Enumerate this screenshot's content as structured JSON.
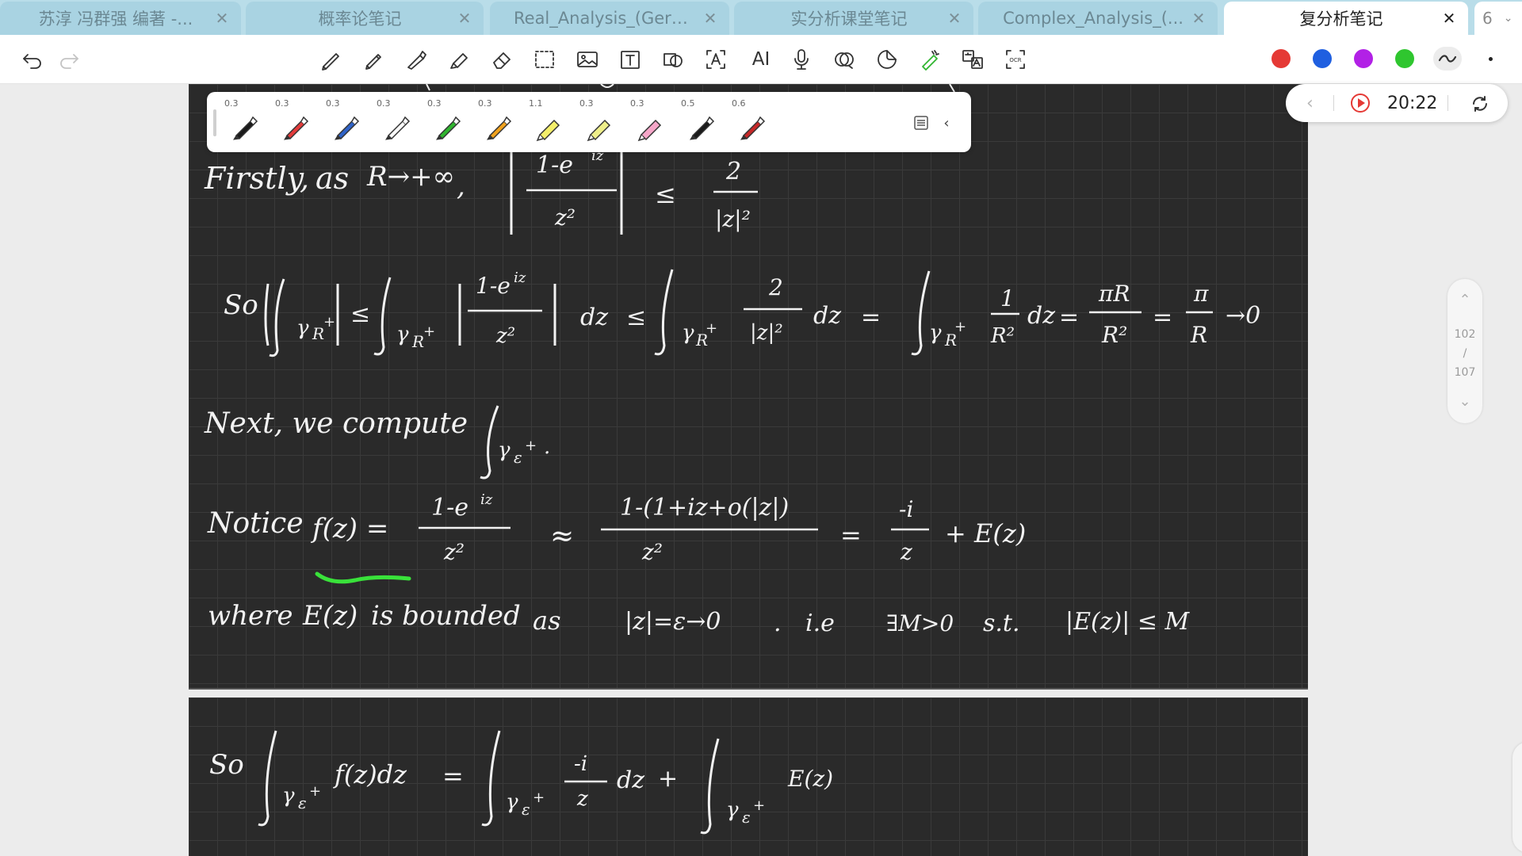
{
  "tabs": [
    {
      "label": "苏淳 冯群强 编著 -...",
      "active": false
    },
    {
      "label": "概率论笔记",
      "active": false
    },
    {
      "label": "Real_Analysis_(Gera...",
      "active": false
    },
    {
      "label": "实分析课堂笔记",
      "active": false
    },
    {
      "label": "Complex_Analysis_(...",
      "active": false
    },
    {
      "label": "复分析笔记",
      "active": true
    }
  ],
  "tab_overflow": {
    "count": "6",
    "chevron": "chevron-down-icon"
  },
  "toolbar": {
    "tools": [
      "pen-icon",
      "pencil-icon",
      "fountain-pen-icon",
      "highlighter-icon",
      "eraser-icon",
      "lasso-select-icon",
      "image-icon",
      "text-box-icon",
      "shapes-icon",
      "ocr-text-icon",
      "ai-icon",
      "microphone-icon",
      "scissors-icon",
      "sticker-icon",
      "laser-pointer-icon",
      "translate-icon",
      "ocr-scan-icon"
    ],
    "text_box": "T",
    "ocr_text": "A",
    "ai": "AI",
    "ocr_scan": "OCR",
    "colors": [
      "#e53935",
      "#1f5fe0",
      "#b221e6",
      "#2fc62f"
    ]
  },
  "pen_palette": {
    "pens": [
      {
        "size": "0.3",
        "color": "#1a1a1a",
        "kind": "pen"
      },
      {
        "size": "0.3",
        "color": "#e23b3b",
        "kind": "pen"
      },
      {
        "size": "0.3",
        "color": "#2f63c8",
        "kind": "pen"
      },
      {
        "size": "0.3",
        "color": "#ffffff",
        "kind": "pen"
      },
      {
        "size": "0.3",
        "color": "#2fb52f",
        "kind": "pen"
      },
      {
        "size": "0.3",
        "color": "#f0a21e",
        "kind": "pen"
      },
      {
        "size": "1.1",
        "color": "#f3ee6a",
        "kind": "highlighter"
      },
      {
        "size": "0.3",
        "color": "#eeee8a",
        "kind": "highlighter"
      },
      {
        "size": "0.3",
        "color": "#f5a6c8",
        "kind": "highlighter"
      },
      {
        "size": "0.5",
        "color": "#1a1a1a",
        "kind": "pen"
      },
      {
        "size": "0.6",
        "color": "#c62828",
        "kind": "pen"
      }
    ]
  },
  "timer": {
    "time": "20:22"
  },
  "page_nav": {
    "current": "102",
    "separator": "/",
    "total": "107"
  },
  "notes": {
    "line1": {
      "firstly": "Firstly,",
      "as": "as",
      "limit": "R→+∞",
      "comma": ",",
      "num": "1-e",
      "num_sup": "iz",
      "den": "z²",
      "le": "≤",
      "rhs_num": "2",
      "rhs_den": "|z|²"
    },
    "line2": {
      "so": "So",
      "rgamma": "γ",
      "rsub": "R",
      "plus": "+",
      "num1": "1-e",
      "num1_sup": "iz",
      "den1": "z²",
      "dz": "dz",
      "le": "≤",
      "two": "2",
      "absz2": "|z|²",
      "eq": "=",
      "one": "1",
      "R2": "R²",
      "piR": "πR",
      "pi": "π",
      "R": "R",
      "arrow": "→0"
    },
    "line3": {
      "text": "Next,  we  compute",
      "esub": "ε",
      "dot": "."
    },
    "line4": {
      "notice": "Notice",
      "fz": "f(z) =",
      "num": "1-e",
      "num_sup": "iz",
      "den": "z²",
      "approx": "≈",
      "num2": "1-(1+iz+o(|z|)",
      "den2": "z²",
      "eq": "=",
      "minus_i": "-i",
      "z": "z",
      "plus_E": "+  E(z)"
    },
    "line5": {
      "where": "where",
      "ez": "E(z)",
      "is_bounded": "is  bounded",
      "as": "as",
      "cond": "|z|=ε→0",
      "dot": ".",
      "ie": "i.e",
      "exists": "∃M>0",
      "st": "s.t.",
      "bound": "|E(z)| ≤ M"
    },
    "line6": {
      "so": "So",
      "fdz": "f(z)dz",
      "eq": "=",
      "minus_i": "-i",
      "z": "z",
      "dz": "dz",
      "plus": "+",
      "ez": "E(z)"
    }
  }
}
